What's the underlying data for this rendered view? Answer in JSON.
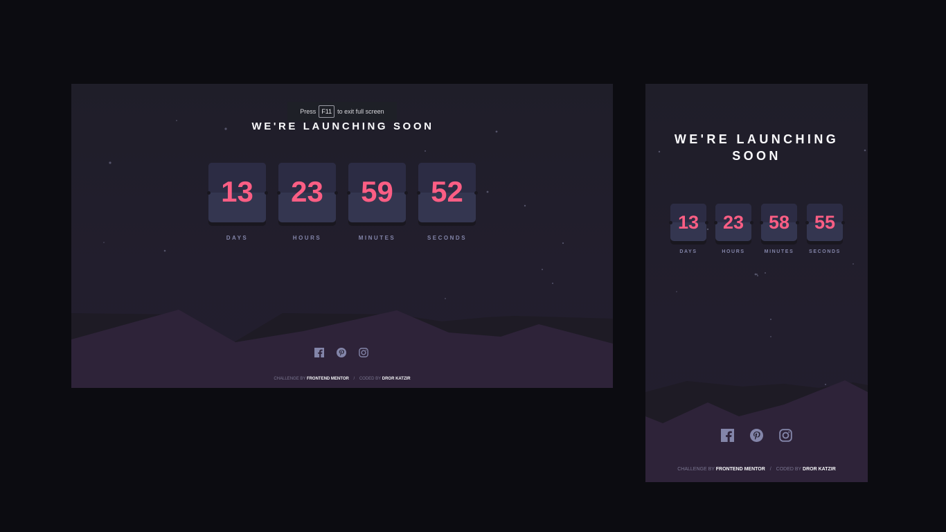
{
  "fullscreen_hint": {
    "prefix": "Press",
    "key": "F11",
    "suffix": "to exit full screen"
  },
  "desktop": {
    "title": "WE'RE LAUNCHING SOON",
    "countdown": [
      {
        "value": "13",
        "label": "DAYS"
      },
      {
        "value": "23",
        "label": "HOURS"
      },
      {
        "value": "59",
        "label": "MINUTES"
      },
      {
        "value": "52",
        "label": "SECONDS"
      }
    ]
  },
  "mobile": {
    "title_line1": "WE'RE LAUNCHING",
    "title_line2": "SOON",
    "countdown": [
      {
        "value": "13",
        "label": "DAYS"
      },
      {
        "value": "23",
        "label": "HOURS"
      },
      {
        "value": "58",
        "label": "MINUTES"
      },
      {
        "value": "55",
        "label": "SECONDS"
      }
    ]
  },
  "social": {
    "icons": [
      "facebook-icon",
      "pinterest-icon",
      "instagram-icon"
    ]
  },
  "credit": {
    "challenge_prefix": "CHALLENGE BY",
    "challenge_link": "FRONTEND MENTOR",
    "separator": "/",
    "coded_prefix": "CODED BY",
    "coded_link": "DROR KATZIR"
  },
  "colors": {
    "accent": "#fb5e84",
    "card": "#343650",
    "label": "#8385a9",
    "hill": "#2f2438",
    "page_bg": "#0c0c11"
  }
}
